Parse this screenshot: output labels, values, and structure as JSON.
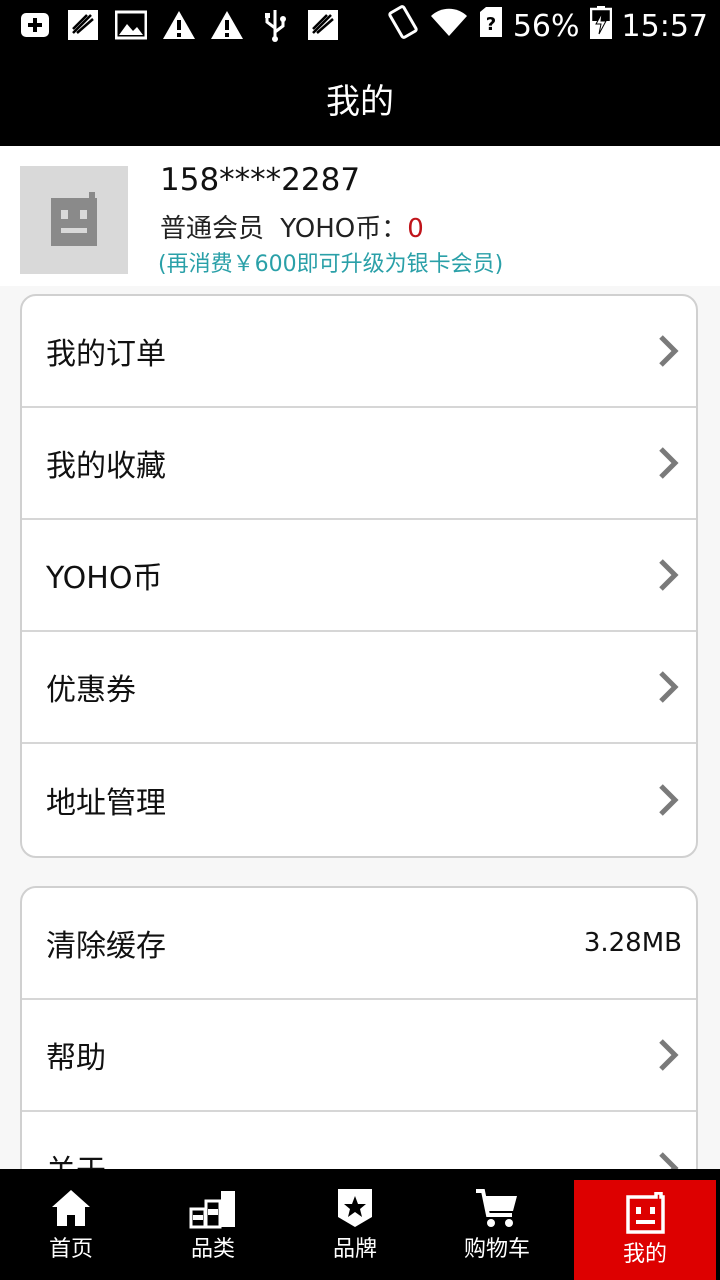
{
  "status_bar": {
    "battery": "56%",
    "time": "15:57"
  },
  "header": {
    "title": "我的"
  },
  "profile": {
    "phone": "158****2287",
    "member_level": "普通会员",
    "coin_label": "YOHO币：",
    "coin_value": "0",
    "upgrade_hint": "(再消费￥600即可升级为银卡会员)"
  },
  "menu_main": [
    {
      "label": "我的订单"
    },
    {
      "label": "我的收藏"
    },
    {
      "label": "YOHO币"
    },
    {
      "label": "优惠券"
    },
    {
      "label": "地址管理"
    }
  ],
  "menu_other": {
    "clear_cache": {
      "label": "清除缓存",
      "value": "3.28MB"
    },
    "help": {
      "label": "帮助"
    },
    "about": {
      "label": "关于"
    }
  },
  "tabbar": [
    {
      "label": "首页",
      "icon": "home-icon"
    },
    {
      "label": "品类",
      "icon": "category-icon"
    },
    {
      "label": "品牌",
      "icon": "brand-icon"
    },
    {
      "label": "购物车",
      "icon": "cart-icon"
    },
    {
      "label": "我的",
      "icon": "profile-icon",
      "active": true
    }
  ],
  "colors": {
    "accent": "#dd0000",
    "coin": "#c0141a",
    "hint": "#2aa0a8"
  }
}
